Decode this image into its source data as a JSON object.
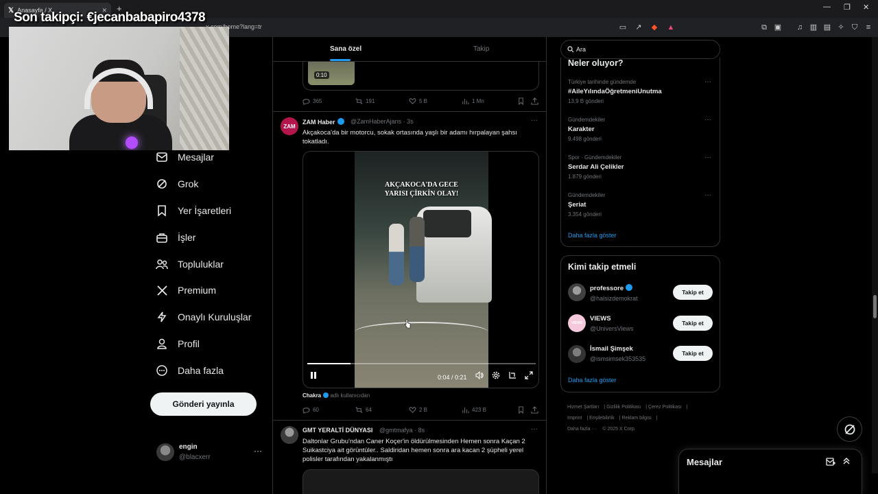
{
  "browser": {
    "tab_title": "Anasayfa / X",
    "url": "x.com/home?lang=tr"
  },
  "stream": {
    "overlay_text": "Son takipçi: €jecanbabapiro4378"
  },
  "nav": {
    "items": [
      {
        "label": "Mesajlar",
        "icon": "mail-icon"
      },
      {
        "label": "Grok",
        "icon": "grok-icon"
      },
      {
        "label": "Yer İşaretleri",
        "icon": "bookmark-icon"
      },
      {
        "label": "İşler",
        "icon": "briefcase-icon"
      },
      {
        "label": "Topluluklar",
        "icon": "people-icon"
      },
      {
        "label": "Premium",
        "icon": "x-logo-icon"
      },
      {
        "label": "Onaylı Kuruluşlar",
        "icon": "lightning-icon"
      },
      {
        "label": "Profil",
        "icon": "person-icon"
      },
      {
        "label": "Daha fazla",
        "icon": "more-circle-icon"
      }
    ],
    "post_button": "Gönderi yayınla",
    "account": {
      "name": "engin",
      "handle": "@blacxerr",
      "more": "···"
    }
  },
  "timeline": {
    "tabs": {
      "active": "Sana özel",
      "inactive": "Takip"
    },
    "prev_tweet": {
      "video_time": "0:10",
      "replies": "365",
      "reposts": "191",
      "likes": "5 B",
      "views": "1 Mn"
    },
    "tweet1": {
      "name": "ZAM Haber",
      "handle": "@ZamHaberAjans",
      "time": "· 3s",
      "text": "Akçakoca'da bir motorcu, sokak ortasında yaşlı bir adamı hırpalayan şahsı tokatladı.",
      "video_title_line1": "AKÇAKOCA'DA GECE",
      "video_title_line2": "YARISI ÇİRKİN OLAY!",
      "video_time": "0:04 / 0:21",
      "video_progress_fraction": 0.19,
      "source_user": "Chakra",
      "source_suffix": "adlı kullanıcıdan",
      "replies": "60",
      "reposts": "64",
      "likes": "2 B",
      "views": "423 B"
    },
    "tweet2": {
      "name": "GMT YERALTİ DÜNYASI",
      "handle": "@gmtmafya",
      "time": "· 8s",
      "text": "Daltonlar Grubu'ndan Caner Koçer'in öldürülmesinden Hemen sonra Kaçan 2 Suikastciya  ait görüntüler.. Saldiridan hemen sonra ara kacan 2 şüpheli yerel polisler tarafından yakalanmıştı"
    }
  },
  "right": {
    "search_placeholder": "Ara",
    "trends_title": "Neler oluyor?",
    "trends": [
      {
        "meta": "Türkiye tarihinde gündemde",
        "name": "#AileYılındaÖğretmeniUnutma",
        "count": "13,9 B gönderi"
      },
      {
        "meta": "Gündemdekiler",
        "name": "Karakter",
        "count": "9.498 gönderi"
      },
      {
        "meta": "Spor · Gündemdekiler",
        "name": "Serdar Ali Çelikler",
        "count": "1.879 gönderi"
      },
      {
        "meta": "Gündemdekiler",
        "name": "Şeriat",
        "count": "3.354 gönderi"
      }
    ],
    "trends_more": "Daha fazla göster",
    "follow_title": "Kimi takip etmeli",
    "follow": [
      {
        "name": "professore",
        "handle": "@halsizdemokrat",
        "button": "Takip et",
        "verified": true
      },
      {
        "name": "VIEWS",
        "handle": "@UniversViews",
        "button": "Takip et",
        "verified": false
      },
      {
        "name": "İsmail Şimşek",
        "handle": "@ismsimsek353535",
        "button": "Takip et",
        "verified": false
      }
    ],
    "follow_more": "Daha fazla göster",
    "footer": [
      "Hizmet Şartları",
      "Gizlilik Politikası",
      "Çerez Politikası",
      "Imprint",
      "Erişilebilirlik",
      "Reklam bilgisi",
      "Daha fazla ···",
      "© 2025 X Corp."
    ]
  },
  "messages_drawer": {
    "title": "Mesajlar"
  },
  "colors": {
    "accent": "#1d9bf0",
    "background": "#000000",
    "border": "#2f3336",
    "muted": "#71767b"
  }
}
